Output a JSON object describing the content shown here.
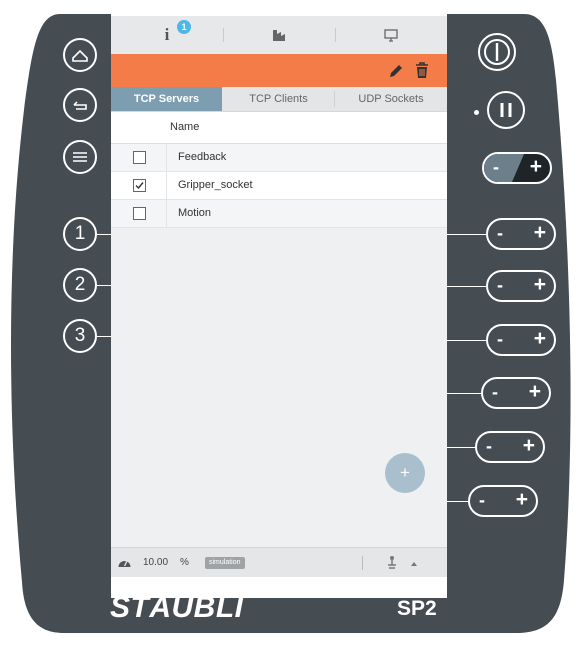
{
  "topbar": {
    "info_label": "i",
    "info_badge": "1",
    "icons": [
      "info-icon",
      "tool-icon",
      "monitor-icon"
    ]
  },
  "edit_bar": {
    "color": "#f47c49",
    "icons": [
      "pencil-icon",
      "trash-icon"
    ]
  },
  "tabs": [
    {
      "label": "TCP Servers",
      "active": true
    },
    {
      "label": "TCP Clients",
      "active": false
    },
    {
      "label": "UDP Sockets",
      "active": false
    }
  ],
  "table": {
    "header": "Name",
    "rows": [
      {
        "label": "Feedback",
        "checked": false
      },
      {
        "label": "Gripper_socket",
        "checked": true
      },
      {
        "label": "Motion",
        "checked": false
      }
    ]
  },
  "add_button": "+",
  "status": {
    "speed_value": "10.00",
    "speed_unit": "%",
    "mode_badge": "simulation"
  },
  "pendant": {
    "brand": "STÄUBLI",
    "model": "SP2",
    "left_buttons": [
      "home-icon",
      "back-icon",
      "menu-icon"
    ],
    "numbered_buttons": [
      "1",
      "2",
      "3"
    ],
    "jog_minus": "-",
    "jog_plus": "+"
  }
}
